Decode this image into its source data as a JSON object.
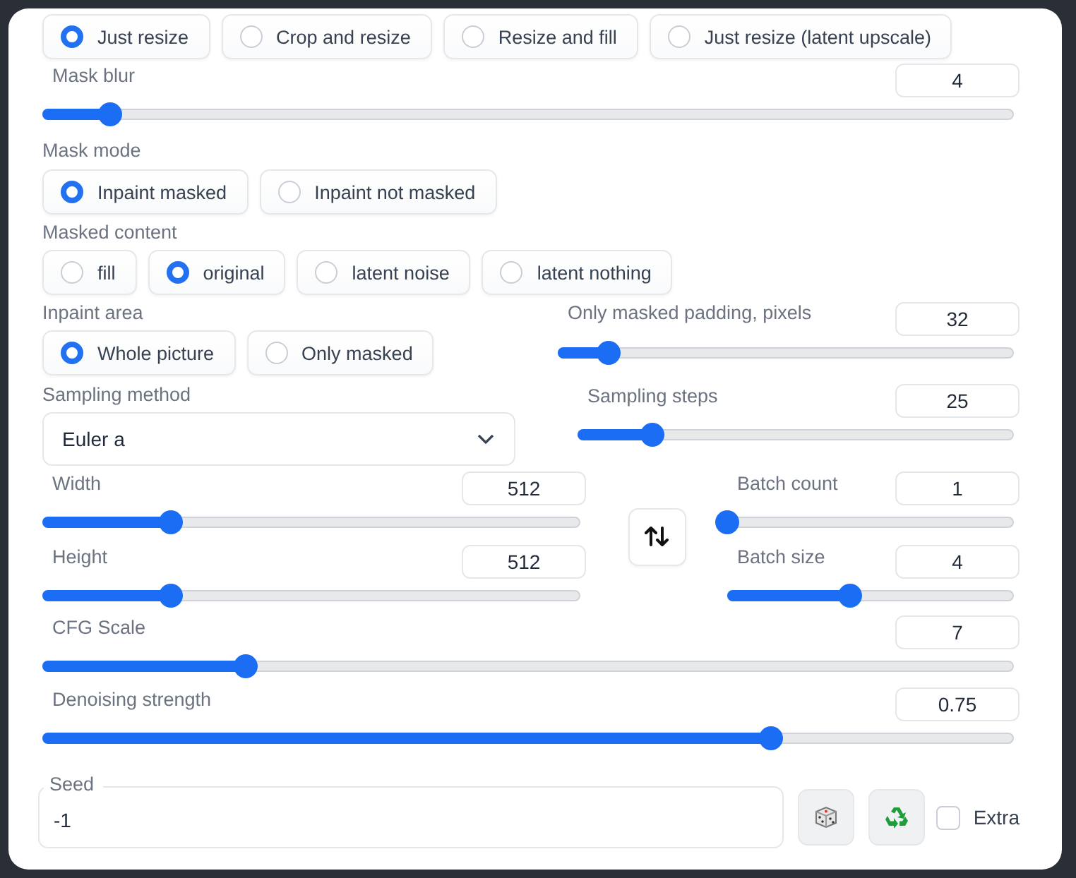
{
  "resize_mode": {
    "options": [
      {
        "label": "Just resize",
        "selected": true
      },
      {
        "label": "Crop and resize",
        "selected": false
      },
      {
        "label": "Resize and fill",
        "selected": false
      },
      {
        "label": "Just resize (latent upscale)",
        "selected": false
      }
    ]
  },
  "mask_blur": {
    "label": "Mask blur",
    "value": "4",
    "level": 0.07
  },
  "mask_mode": {
    "label": "Mask mode",
    "options": [
      {
        "label": "Inpaint masked",
        "selected": true
      },
      {
        "label": "Inpaint not masked",
        "selected": false
      }
    ]
  },
  "masked_content": {
    "label": "Masked content",
    "options": [
      {
        "label": "fill",
        "selected": false
      },
      {
        "label": "original",
        "selected": true
      },
      {
        "label": "latent noise",
        "selected": false
      },
      {
        "label": "latent nothing",
        "selected": false
      }
    ]
  },
  "inpaint_area": {
    "label": "Inpaint area",
    "options": [
      {
        "label": "Whole picture",
        "selected": true
      },
      {
        "label": "Only masked",
        "selected": false
      }
    ]
  },
  "only_masked_padding": {
    "label": "Only masked padding, pixels",
    "value": "32",
    "level": 0.11
  },
  "sampling_method": {
    "label": "Sampling method",
    "value": "Euler a"
  },
  "sampling_steps": {
    "label": "Sampling steps",
    "value": "25",
    "level": 0.17
  },
  "width": {
    "label": "Width",
    "value": "512",
    "level": 0.24
  },
  "height": {
    "label": "Height",
    "value": "512",
    "level": 0.24
  },
  "batch_count": {
    "label": "Batch count",
    "value": "1",
    "level": 0
  },
  "batch_size": {
    "label": "Batch size",
    "value": "4",
    "level": 0.43
  },
  "cfg_scale": {
    "label": "CFG Scale",
    "value": "7",
    "level": 0.21
  },
  "denoising_strength": {
    "label": "Denoising strength",
    "value": "0.75",
    "level": 0.75
  },
  "seed": {
    "label": "Seed",
    "value": "-1"
  },
  "extra": {
    "label": "Extra",
    "checked": false
  }
}
